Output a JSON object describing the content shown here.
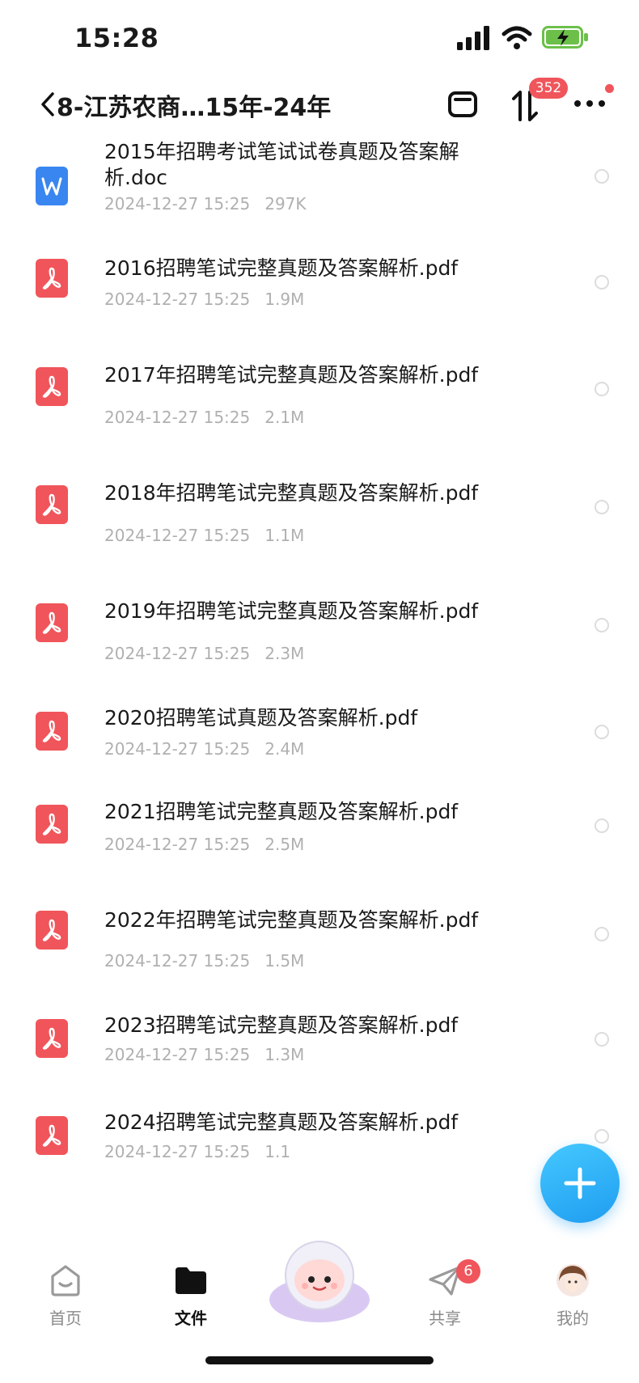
{
  "status_bar": {
    "time": "15:28"
  },
  "header": {
    "title": "8-江苏农商…15年-24年",
    "sort_badge": "352"
  },
  "files": [
    {
      "type": "doc",
      "name": "2015年招聘考试笔试试卷真题及答案解析.doc",
      "date": "2024-12-27 15:25",
      "size": "297K"
    },
    {
      "type": "pdf",
      "name": "2016招聘笔试完整真题及答案解析.pdf",
      "date": "2024-12-27 15:25",
      "size": "1.9M"
    },
    {
      "type": "pdf",
      "name": "2017年招聘笔试完整真题及答案解析.pdf",
      "date": "2024-12-27 15:25",
      "size": "2.1M"
    },
    {
      "type": "pdf",
      "name": "2018年招聘笔试完整真题及答案解析.pdf",
      "date": "2024-12-27 15:25",
      "size": "1.1M"
    },
    {
      "type": "pdf",
      "name": "2019年招聘笔试完整真题及答案解析.pdf",
      "date": "2024-12-27 15:25",
      "size": "2.3M"
    },
    {
      "type": "pdf",
      "name": "2020招聘笔试真题及答案解析.pdf",
      "date": "2024-12-27 15:25",
      "size": "2.4M"
    },
    {
      "type": "pdf",
      "name": "2021招聘笔试完整真题及答案解析.pdf",
      "date": "2024-12-27 15:25",
      "size": "2.5M"
    },
    {
      "type": "pdf",
      "name": "2022年招聘笔试完整真题及答案解析.pdf",
      "date": "2024-12-27 15:25",
      "size": "1.5M"
    },
    {
      "type": "pdf",
      "name": "2023招聘笔试完整真题及答案解析.pdf",
      "date": "2024-12-27 15:25",
      "size": "1.3M"
    },
    {
      "type": "pdf",
      "name": "2024招聘笔试完整真题及答案解析.pdf",
      "date": "2024-12-27 15:25",
      "size": "1.1"
    }
  ],
  "tabbar": {
    "home": "首页",
    "files": "文件",
    "share": "共享",
    "share_badge": "6",
    "mine": "我的"
  },
  "colors": {
    "accent": "#1f9df0",
    "badge": "#f0555b",
    "pdf": "#f0555b",
    "doc": "#3a86f0"
  }
}
